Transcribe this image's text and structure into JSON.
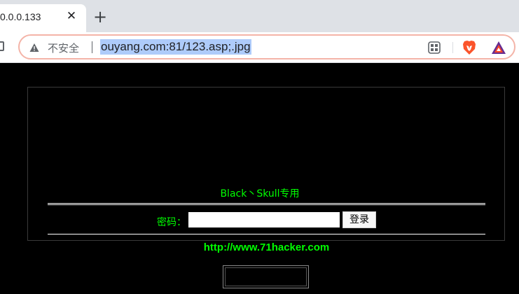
{
  "browser": {
    "tab": {
      "title": "0.0.0.133",
      "close_glyph": "✕"
    },
    "new_tab_glyph": "+",
    "omnibox": {
      "security_label": "不安全",
      "url": "ouyang.com:81/123.asp;.jpg"
    },
    "icons": {
      "warning": "warning-icon",
      "qr": "qr-code-icon",
      "brave": "brave-lion-icon",
      "bat": "bat-rewards-icon"
    }
  },
  "page": {
    "heading": "Black丶Skull专用",
    "password_label": "密码：",
    "password_value": "",
    "login_label": "登录",
    "link_text": "http://www.71hacker.com",
    "colors": {
      "background": "#000000",
      "text": "#00ff00",
      "rule": "#ffffff"
    }
  }
}
